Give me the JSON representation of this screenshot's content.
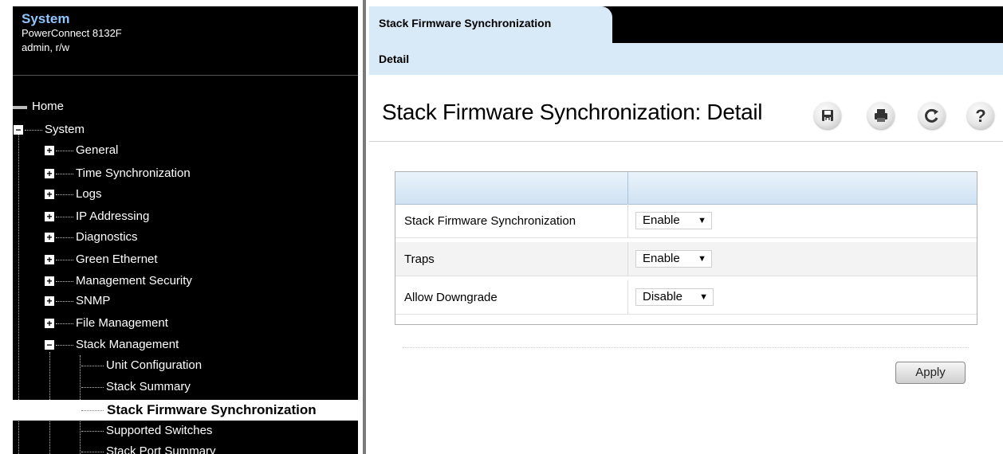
{
  "sidebar": {
    "system_title": "System",
    "model": "PowerConnect 8132F",
    "user": "admin, r/w",
    "tree": {
      "home": "Home",
      "system": "System",
      "items": [
        "General",
        "Time Synchronization",
        "Logs",
        "IP Addressing",
        "Diagnostics",
        "Green Ethernet",
        "Management Security",
        "SNMP",
        "File Management",
        "Stack Management"
      ],
      "stack_children": [
        "Unit Configuration",
        "Stack Summary",
        "Stack Firmware Synchronization",
        "Supported Switches",
        "Stack Port Summary"
      ]
    }
  },
  "main": {
    "tab": "Stack Firmware Synchronization",
    "subtab": "Detail",
    "title": "Stack Firmware Synchronization: Detail",
    "toolbar": [
      "save-icon",
      "print-icon",
      "refresh-icon",
      "help-icon"
    ],
    "rows": [
      {
        "label": "Stack Firmware Synchronization",
        "value": "Enable"
      },
      {
        "label": "Traps",
        "value": "Enable"
      },
      {
        "label": "Allow Downgrade",
        "value": "Disable"
      }
    ],
    "apply_label": "Apply"
  }
}
